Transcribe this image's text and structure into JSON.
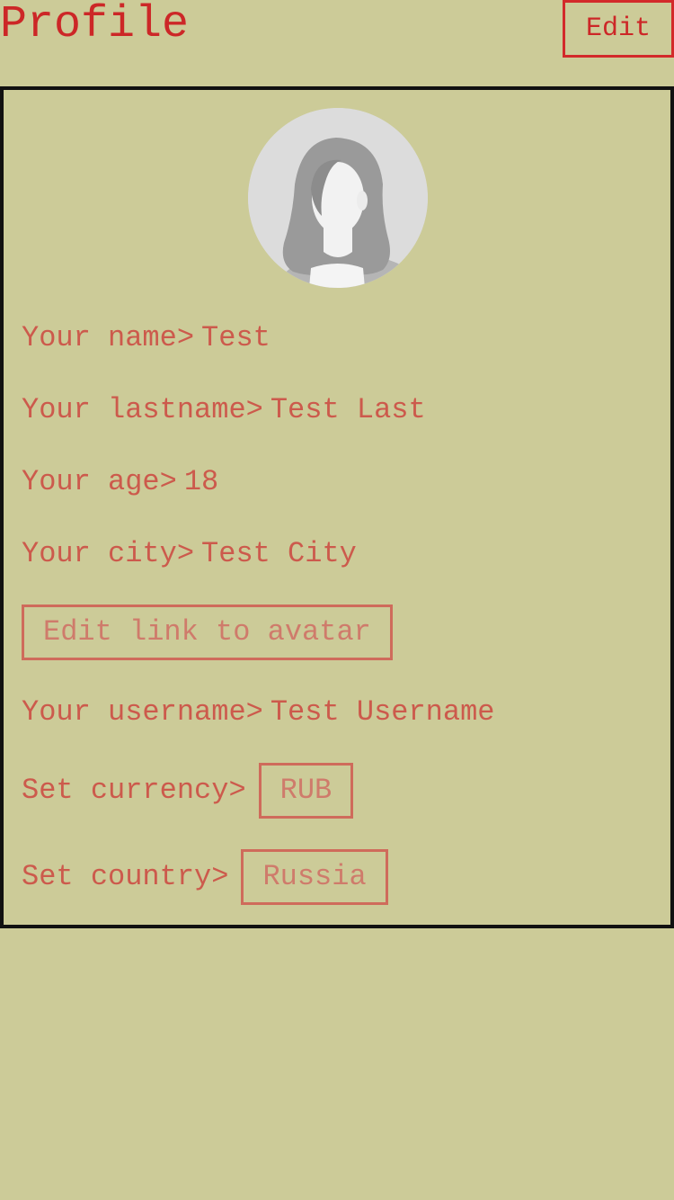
{
  "header": {
    "title": "Profile",
    "edit_label": "Edit"
  },
  "avatar": {
    "icon": "default-female-avatar-icon"
  },
  "fields": {
    "name_label": "Your name>",
    "name_value": "Test",
    "lastname_label": "Your lastname>",
    "lastname_value": "Test Last",
    "age_label": "Your age>",
    "age_value": "18",
    "city_label": "Your city>",
    "city_value": "Test City",
    "edit_avatar_label": "Edit link to avatar",
    "username_label": "Your username>",
    "username_value": "Test Username",
    "currency_label": "Set currency>",
    "currency_value": "RUB",
    "country_label": "Set country>",
    "country_value": "Russia"
  },
  "colors": {
    "background": "#cccb98",
    "title_red": "#cc2727",
    "text_red": "#cc5a4c",
    "outline_red": "#cf6b5b",
    "card_border": "#111111"
  }
}
